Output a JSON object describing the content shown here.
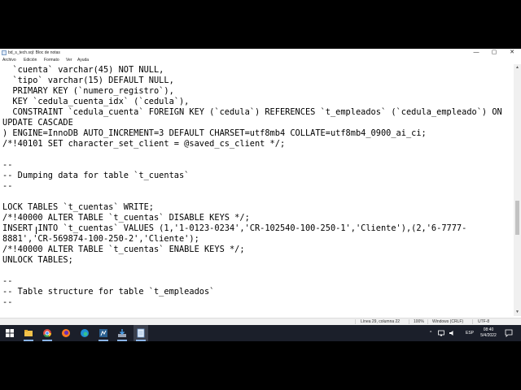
{
  "window": {
    "title": "bd_s_tech.sql: Bloc de notas",
    "icon": "notepad-icon",
    "controls": {
      "minimize": "—",
      "maximize": "▢",
      "close": "✕"
    }
  },
  "menu": [
    "Archivo",
    "Edición",
    "Formato",
    "Ver",
    "Ayuda"
  ],
  "editor": {
    "lines": [
      "  `cuenta` varchar(45) NOT NULL,",
      "  `tipo` varchar(15) DEFAULT NULL,",
      "  PRIMARY KEY (`numero_registro`),",
      "  KEY `cedula_cuenta_idx` (`cedula`),",
      "  CONSTRAINT `cedula_cuenta` FOREIGN KEY (`cedula`) REFERENCES `t_empleados` (`cedula_empleado`) ON",
      "UPDATE CASCADE",
      ") ENGINE=InnoDB AUTO_INCREMENT=3 DEFAULT CHARSET=utf8mb4 COLLATE=utf8mb4_0900_ai_ci;",
      "/*!40101 SET character_set_client = @saved_cs_client */;",
      "",
      "--",
      "-- Dumping data for table `t_cuentas`",
      "--",
      "",
      "LOCK TABLES `t_cuentas` WRITE;",
      "/*!40000 ALTER TABLE `t_cuentas` DISABLE KEYS */;",
      "INSERT INTO `t_cuentas` VALUES (1,'1-0123-0234','CR-102540-100-250-1','Cliente'),(2,'6-7777-",
      "8881','CR-569874-100-250-2','Cliente');",
      "/*!40000 ALTER TABLE `t_cuentas` ENABLE KEYS */;",
      "UNLOCK TABLES;",
      "",
      "--",
      "-- Table structure for table `t_empleados`",
      "--"
    ]
  },
  "statusbar": {
    "position": "Línea 29, columna 22",
    "zoom": "100%",
    "line_ending": "Windows (CRLF)",
    "encoding": "UTF-8"
  },
  "taskbar": {
    "apps": [
      "windows-start-icon",
      "file-explorer-icon",
      "chrome-icon",
      "firefox-icon",
      "edge-icon",
      "mysql-workbench-icon",
      "installer-icon",
      "notepad-icon"
    ],
    "tray": {
      "chevron": "^",
      "language": "ESP",
      "time": "08:40",
      "date": "5/4/2022"
    }
  }
}
